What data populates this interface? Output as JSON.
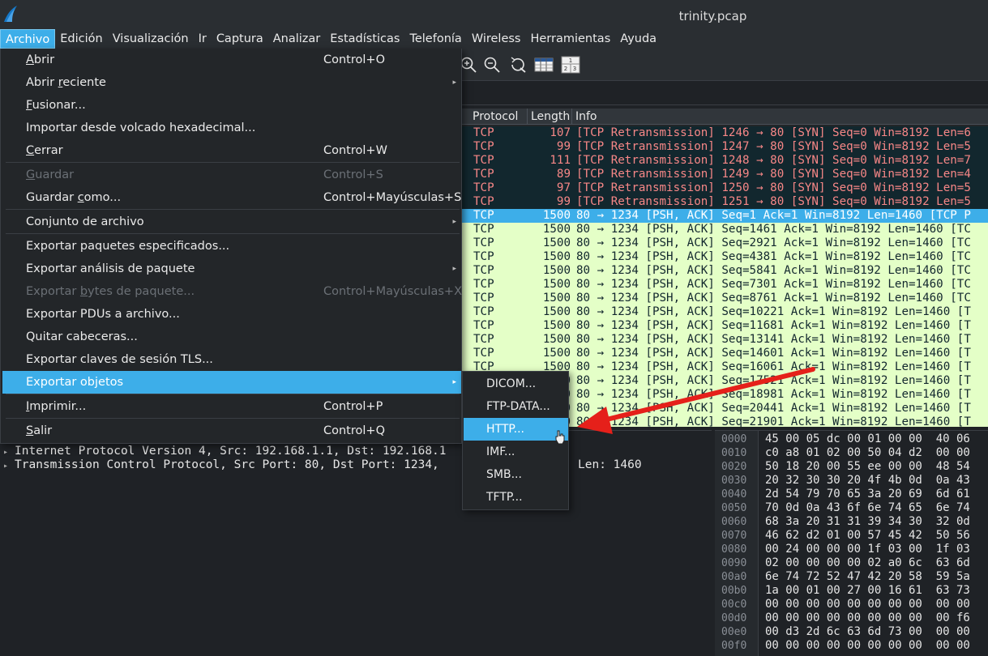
{
  "window": {
    "title": "trinity.pcap"
  },
  "menubar": [
    {
      "label": "Archivo",
      "active": true
    },
    {
      "label": "Edición"
    },
    {
      "label": "Visualización"
    },
    {
      "label": "Ir"
    },
    {
      "label": "Captura"
    },
    {
      "label": "Analizar"
    },
    {
      "label": "Estadísticas"
    },
    {
      "label": "Telefonía"
    },
    {
      "label": "Wireless"
    },
    {
      "label": "Herramientas"
    },
    {
      "label": "Ayuda"
    }
  ],
  "toolbar": {
    "icons": [
      "zoom-in-icon",
      "zoom-out-icon",
      "zoom-reset-icon",
      "resize-columns-icon",
      "columns-layout-icon"
    ]
  },
  "archivo_menu": {
    "items": [
      {
        "pre": "",
        "ul": "A",
        "post": "brir",
        "shortcut": "Control+O"
      },
      {
        "pre": "Abrir ",
        "ul": "r",
        "post": "eciente",
        "shortcut": "",
        "submenu": true
      },
      {
        "pre": "",
        "ul": "F",
        "post": "usionar...",
        "shortcut": ""
      },
      {
        "pre": "Importar desde volcado hexadecimal...",
        "ul": "",
        "post": "",
        "shortcut": ""
      },
      {
        "pre": "",
        "ul": "C",
        "post": "errar",
        "shortcut": "Control+W"
      },
      {
        "pre": "",
        "ul": "G",
        "post": "uardar",
        "shortcut": "Control+S",
        "disabled": true
      },
      {
        "pre": "Guardar ",
        "ul": "c",
        "post": "omo...",
        "shortcut": "Control+Mayúsculas+S"
      },
      {
        "pre": "Conjunto de archivo",
        "ul": "",
        "post": "",
        "shortcut": "",
        "submenu": true
      },
      {
        "pre": "Exportar paquetes especificados...",
        "ul": "",
        "post": "",
        "shortcut": ""
      },
      {
        "pre": "Exportar análisis de paquete",
        "ul": "",
        "post": "",
        "shortcut": "",
        "submenu": true
      },
      {
        "pre": "Exportar ",
        "ul": "b",
        "post": "ytes de paquete...",
        "shortcut": "Control+Mayúsculas+X",
        "disabled": true
      },
      {
        "pre": "Exportar PDUs a archivo...",
        "ul": "",
        "post": "",
        "shortcut": ""
      },
      {
        "pre": "Quitar cabeceras...",
        "ul": "",
        "post": "",
        "shortcut": ""
      },
      {
        "pre": "Exportar claves de sesión TLS...",
        "ul": "",
        "post": "",
        "shortcut": ""
      },
      {
        "pre": "Exportar objetos",
        "ul": "",
        "post": "",
        "shortcut": "",
        "submenu": true,
        "highlight": true
      },
      {
        "pre": "",
        "ul": "I",
        "post": "mprimir...",
        "shortcut": "Control+P"
      },
      {
        "pre": "",
        "ul": "S",
        "post": "alir",
        "shortcut": "Control+Q"
      }
    ]
  },
  "export_submenu": {
    "items": [
      {
        "label": "DICOM..."
      },
      {
        "label": "FTP-DATA..."
      },
      {
        "label": "HTTP...",
        "highlight": true
      },
      {
        "label": "IMF..."
      },
      {
        "label": "SMB..."
      },
      {
        "label": "TFTP..."
      }
    ]
  },
  "packet_list": {
    "columns": [
      "Protocol",
      "Length",
      "Info"
    ],
    "rows": [
      {
        "protocol": "TCP",
        "length": "107",
        "info": "[TCP Retransmission] 1246 → 80 [SYN] Seq=0 Win=8192 Len=6",
        "style": "retrans"
      },
      {
        "protocol": "TCP",
        "length": "99",
        "info": "[TCP Retransmission] 1247 → 80 [SYN] Seq=0 Win=8192 Len=5",
        "style": "retrans"
      },
      {
        "protocol": "TCP",
        "length": "111",
        "info": "[TCP Retransmission] 1248 → 80 [SYN] Seq=0 Win=8192 Len=7",
        "style": "retrans"
      },
      {
        "protocol": "TCP",
        "length": "89",
        "info": "[TCP Retransmission] 1249 → 80 [SYN] Seq=0 Win=8192 Len=4",
        "style": "retrans"
      },
      {
        "protocol": "TCP",
        "length": "97",
        "info": "[TCP Retransmission] 1250 → 80 [SYN] Seq=0 Win=8192 Len=5",
        "style": "retrans"
      },
      {
        "protocol": "TCP",
        "length": "99",
        "info": "[TCP Retransmission] 1251 → 80 [SYN] Seq=0 Win=8192 Len=5",
        "style": "retrans"
      },
      {
        "protocol": "TCP",
        "length": "1500",
        "info": "80 → 1234 [PSH, ACK] Seq=1 Ack=1 Win=8192 Len=1460 [TCP P",
        "style": "selected"
      },
      {
        "protocol": "TCP",
        "length": "1500",
        "info": "80 → 1234 [PSH, ACK] Seq=1461 Ack=1 Win=8192 Len=1460 [TC",
        "style": "normal"
      },
      {
        "protocol": "TCP",
        "length": "1500",
        "info": "80 → 1234 [PSH, ACK] Seq=2921 Ack=1 Win=8192 Len=1460 [TC",
        "style": "normal"
      },
      {
        "protocol": "TCP",
        "length": "1500",
        "info": "80 → 1234 [PSH, ACK] Seq=4381 Ack=1 Win=8192 Len=1460 [TC",
        "style": "normal"
      },
      {
        "protocol": "TCP",
        "length": "1500",
        "info": "80 → 1234 [PSH, ACK] Seq=5841 Ack=1 Win=8192 Len=1460 [TC",
        "style": "normal"
      },
      {
        "protocol": "TCP",
        "length": "1500",
        "info": "80 → 1234 [PSH, ACK] Seq=7301 Ack=1 Win=8192 Len=1460 [TC",
        "style": "normal"
      },
      {
        "protocol": "TCP",
        "length": "1500",
        "info": "80 → 1234 [PSH, ACK] Seq=8761 Ack=1 Win=8192 Len=1460 [TC",
        "style": "normal"
      },
      {
        "protocol": "TCP",
        "length": "1500",
        "info": "80 → 1234 [PSH, ACK] Seq=10221 Ack=1 Win=8192 Len=1460 [T",
        "style": "normal"
      },
      {
        "protocol": "TCP",
        "length": "1500",
        "info": "80 → 1234 [PSH, ACK] Seq=11681 Ack=1 Win=8192 Len=1460 [T",
        "style": "normal"
      },
      {
        "protocol": "TCP",
        "length": "1500",
        "info": "80 → 1234 [PSH, ACK] Seq=13141 Ack=1 Win=8192 Len=1460 [T",
        "style": "normal"
      },
      {
        "protocol": "TCP",
        "length": "1500",
        "info": "80 → 1234 [PSH, ACK] Seq=14601 Ack=1 Win=8192 Len=1460 [T",
        "style": "normal"
      },
      {
        "protocol": "TCP",
        "length": "1500",
        "info": "80 → 1234 [PSH, ACK] Seq=16061 Ack=1 Win=8192 Len=1460 [T",
        "style": "normal"
      },
      {
        "protocol": "TCP",
        "length": "1500",
        "info": "80 → 1234 [PSH, ACK] Seq=17521 Ack=1 Win=8192 Len=1460 [T",
        "style": "normal"
      },
      {
        "protocol": "TCP",
        "length": "1500",
        "info": "80 → 1234 [PSH, ACK] Seq=18981 Ack=1 Win=8192 Len=1460 [T",
        "style": "normal"
      },
      {
        "protocol": "TCP",
        "length": "1500",
        "info": "80 → 1234 [PSH, ACK] Seq=20441 Ack=1 Win=8192 Len=1460 [T",
        "style": "normal"
      },
      {
        "protocol": "TCP",
        "length": "1500",
        "info": "80 → 1234 [PSH, ACK] Seq=21901 Ack=1 Win=8192 Len=1460 [T",
        "style": "normal"
      }
    ]
  },
  "details": {
    "rows": [
      "Internet Protocol Version 4, Src: 192.168.1.1, Dst: 192.168.1",
      "Transmission Control Protocol, Src Port: 80, Dst Port: 1234,"
    ],
    "trailing": "Len: 1460"
  },
  "hex": {
    "rows": [
      {
        "offset": "0000",
        "bytes": "45 00 05 dc 00 01 00 00  40 06"
      },
      {
        "offset": "0010",
        "bytes": "c0 a8 01 02 00 50 04 d2  00 00"
      },
      {
        "offset": "0020",
        "bytes": "50 18 20 00 55 ee 00 00  48 54"
      },
      {
        "offset": "0030",
        "bytes": "20 32 30 30 20 4f 4b 0d  0a 43"
      },
      {
        "offset": "0040",
        "bytes": "2d 54 79 70 65 3a 20 69  6d 61"
      },
      {
        "offset": "0050",
        "bytes": "70 0d 0a 43 6f 6e 74 65  6e 74"
      },
      {
        "offset": "0060",
        "bytes": "68 3a 20 31 31 39 34 30  32 0d"
      },
      {
        "offset": "0070",
        "bytes": "46 62 d2 01 00 57 45 42  50 56"
      },
      {
        "offset": "0080",
        "bytes": "00 24 00 00 00 1f 03 00  1f 03"
      },
      {
        "offset": "0090",
        "bytes": "02 00 00 00 00 02 a0 6c  63 6d"
      },
      {
        "offset": "00a0",
        "bytes": "6e 74 72 52 47 42 20 58  59 5a"
      },
      {
        "offset": "00b0",
        "bytes": "1a 00 01 00 27 00 16 61  63 73"
      },
      {
        "offset": "00c0",
        "bytes": "00 00 00 00 00 00 00 00  00 00"
      },
      {
        "offset": "00d0",
        "bytes": "00 00 00 00 00 00 00 00  00 f6"
      },
      {
        "offset": "00e0",
        "bytes": "00 d3 2d 6c 63 6d 73 00  00 00"
      },
      {
        "offset": "00f0",
        "bytes": "00 00 00 00 00 00 00 00  00 00"
      }
    ]
  }
}
